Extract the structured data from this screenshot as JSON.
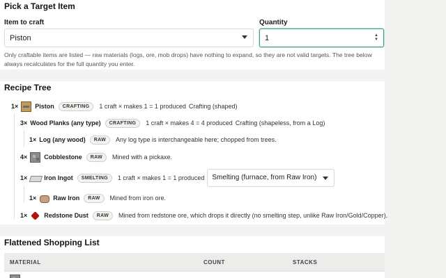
{
  "target": {
    "heading": "Pick a Target Item",
    "item_label": "Item to craft",
    "item_value": "Piston",
    "quantity_label": "Quantity",
    "quantity_value": "1",
    "hint": "Only craftable items are listed — raw materials (logs, ore, mob drops) have nothing to expand, so they are not valid targets. The tree below always recalculates for the full quantity you enter."
  },
  "tree": {
    "heading": "Recipe Tree",
    "nodes": [
      {
        "qty": "1×",
        "name": "Piston",
        "badge": "CRAFTING",
        "desc": "1 craft × makes 1 = 1 produced",
        "method": "Crafting (shaped)",
        "icon": "piston-icon"
      },
      {
        "qty": "3×",
        "name": "Wood Planks (any type)",
        "badge": "CRAFTING",
        "desc": "1 craft × makes 4 = 4 produced",
        "method": "Crafting (shapeless, from a Log)",
        "icon": ""
      },
      {
        "qty": "1×",
        "name": "Log (any wood)",
        "badge": "RAW",
        "desc": "Any log type is interchangeable here; chopped from trees.",
        "icon": ""
      },
      {
        "qty": "4×",
        "name": "Cobblestone",
        "badge": "RAW",
        "desc": "Mined with a pickaxe.",
        "icon": "cobblestone-icon"
      },
      {
        "qty": "1×",
        "name": "Iron Ingot",
        "badge": "SMELTING",
        "desc": "1 craft × makes 1 = 1 produced",
        "method": "Smelting (furnace, from Raw Iron)",
        "icon": "iron-ingot-icon"
      },
      {
        "qty": "1×",
        "name": "Raw Iron",
        "badge": "RAW",
        "desc": "Mined from iron ore.",
        "icon": "raw-iron-icon"
      },
      {
        "qty": "1×",
        "name": "Redstone Dust",
        "badge": "RAW",
        "desc": "Mined from redstone ore, which drops it directly (no smelting step, unlike Raw Iron/Gold/Copper).",
        "icon": "redstone-icon"
      }
    ]
  },
  "shopping": {
    "heading": "Flattened Shopping List",
    "columns": [
      "MATERIAL",
      "COUNT",
      "STACKS"
    ]
  },
  "colors": {
    "accent": "#3fa37a",
    "card": "#ffffff",
    "background": "#f3f4f2"
  }
}
